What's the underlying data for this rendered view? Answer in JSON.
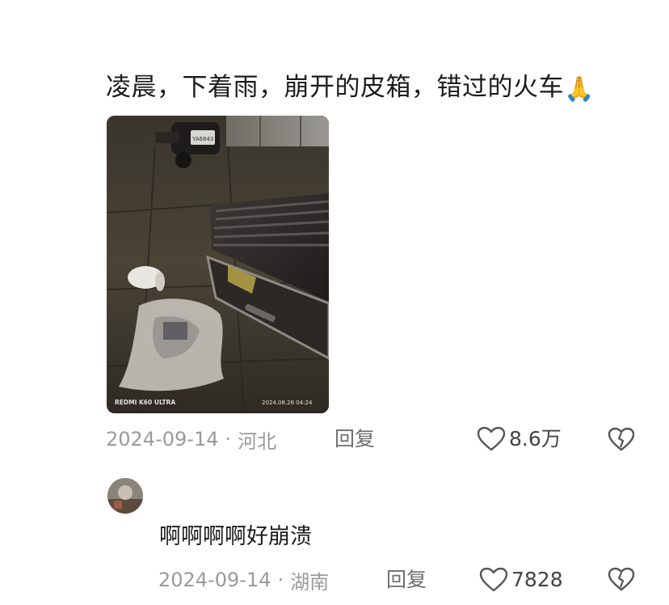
{
  "comment": {
    "text": "凌晨，下着雨，崩开的皮箱，错过的火车",
    "emoji": "🙏",
    "photo": {
      "watermark_left": "REDMI K60 ULTRA",
      "watermark_right": "2024.08.26  04:24",
      "plate": "YA6843"
    },
    "date": "2024-09-14",
    "separator": "·",
    "location": "河北",
    "reply_label": "回复",
    "likes": "8.6万"
  },
  "reply": {
    "text": "啊啊啊啊好崩溃",
    "date": "2024-09-14",
    "separator": "·",
    "location": "湖南",
    "reply_label": "回复",
    "likes": "7828"
  },
  "icons": {
    "like": "heart-outline-icon",
    "dislike": "broken-heart-icon",
    "pray": "folded-hands-emoji"
  },
  "colors": {
    "text": "#1c1c1c",
    "meta": "#9a9a9a",
    "icon": "#555555"
  }
}
